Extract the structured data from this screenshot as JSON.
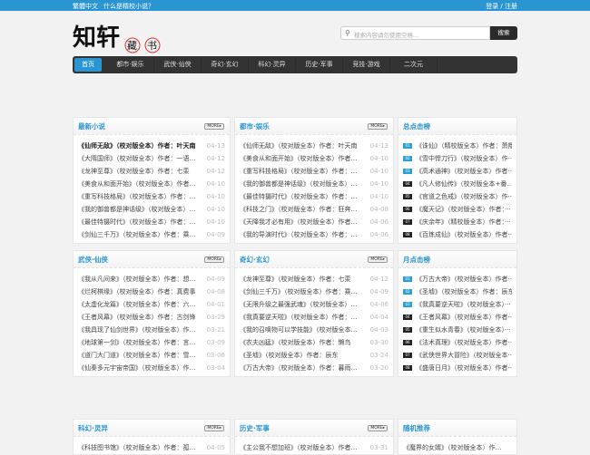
{
  "topbar": {
    "traditional": "繁體中文",
    "about": "什么是精校小说？",
    "login": "登录 / 注册"
  },
  "logo": {
    "text": "知轩藏书"
  },
  "search": {
    "placeholder": "搜索内容请勿使用空格...",
    "button": "搜索"
  },
  "nav": [
    "首页",
    "都市·娱乐",
    "武侠·仙侠",
    "奇幻·玄幻",
    "科幻·灵异",
    "历史·军事",
    "竞技·游戏",
    "二次元"
  ],
  "more": "MORE▸",
  "panels": [
    {
      "title": "最新小说",
      "items": [
        [
          "《仙师无敌》（校对版全本）作者：叶天南",
          "04-13"
        ],
        [
          "《大隋国师》（校对版全本）作者：一语破春风",
          "04-12"
        ],
        [
          "《龙神至尊》（校对版全本）作者：七栾",
          "04-12"
        ],
        [
          "《美食从和面开始》（校对版全本）作者：糖···",
          "04-10"
        ],
        [
          "《重写科技格局》（校对版全本）作者：江湖···",
          "04-10"
        ],
        [
          "《我的御兽都是神话级》（校对版全本）作者···",
          "04-10"
        ],
        [
          "《最佳特摄时代》（校对版全本）作者：粉笔白",
          "04-10"
        ],
        [
          "《剑仙三千万》（校对版全本）作者：乘风御剑",
          "04-09"
        ]
      ]
    },
    {
      "title": "都市·娱乐",
      "items": [
        [
          "《仙师无敌》（校对版全本）作者：叶天南",
          "04-13"
        ],
        [
          "《美食从和面开始》（校对版全本）作者：糖···",
          "04-10"
        ],
        [
          "《重写科技格局》（校对版全本）作者：江湖···",
          "04-10"
        ],
        [
          "《我的御兽都是神话级》（校对版全本）作者···",
          "04-10"
        ],
        [
          "《最佳特摄时代》（校对版全本）作者：粉笔白",
          "04-10"
        ],
        [
          "《科技之门》（校对版全本）作者：狂奔的黑···",
          "04-08"
        ],
        [
          "《天降我才必有用》（校对版全本）作者：石···",
          "04-06"
        ],
        [
          "《我的导演时代》（校对版全本）作者：吃饭···",
          "04-06"
        ]
      ]
    },
    {
      "title": "总点击榜",
      "items": [
        [
          "01",
          "《诛仙》（精校版全本）作者：萧鼎"
        ],
        [
          "02",
          "《雪中悍刀行》（校对版全本）作···"
        ],
        [
          "03",
          "《高术通神》（校对版全本）作者···"
        ],
        [
          "04",
          "《凡人修仙传》（校对版全本+番外···"
        ],
        [
          "05",
          "《官道之色戒》（校对版全本）作···"
        ],
        [
          "06",
          "《魔天记》（校对版全本）作者：···"
        ],
        [
          "07",
          "《庆余年》（精校版全本）作者：···"
        ],
        [
          "08",
          "《百炼成仙》（校对版全本）作者···"
        ]
      ]
    },
    {
      "title": "武侠·仙侠",
      "items": [
        [
          "《我从凡间来》（校对版全本）作者：想见江南",
          "04-09"
        ],
        [
          "《烂柯棋缘》（校对版全本）作者：真费事",
          "04-08"
        ],
        [
          "《太虚化龙篇》（校对版全本）作者：六月观主",
          "04-01"
        ],
        [
          "《王者风幕》（校对版全本）作者：古剑锋",
          "03-29"
        ],
        [
          "《我具现了仙剑世界》（校对版全本）作者：···",
          "03-21"
        ],
        [
          "《地球第一剑》（校对版全本）作者：言归正传",
          "03-09"
        ],
        [
          "《道门大门道》（校对版全本）作者：雪清欢",
          "03-06"
        ],
        [
          "《仙秦多元宇宙帝国》（校对版全本）作者：···",
          "03-04"
        ]
      ]
    },
    {
      "title": "奇幻·玄幻",
      "items": [
        [
          "《龙神至尊》（校对版全本）作者：七栾",
          "04-12"
        ],
        [
          "《剑仙三千万》（校对版全本）作者：乘风御剑",
          "04-09"
        ],
        [
          "《无限升级之最强武魂》（校对版全本）作者···",
          "04-06"
        ],
        [
          "《我真要逆天啦》（校对版全本）作者：柳一条",
          "04-04"
        ],
        [
          "《我的召唤物可以学技能》（校对版全本）作···",
          "04-03"
        ],
        [
          "《农夫凶猛》（校对版全本）作者：懒鸟",
          "03-30"
        ],
        [
          "《圣墟》（校对版全本）作者：辰东",
          "03-24"
        ],
        [
          "《万古大帝》（校对版全本）作者：暮雨神天",
          "03-20"
        ]
      ]
    },
    {
      "title": "月点击榜",
      "items": [
        [
          "01",
          "《万古大帝》（校对版全本）作者···"
        ],
        [
          "02",
          "《圣墟》（校对版全本）作者：辰东"
        ],
        [
          "03",
          "《我真要逆天啦》（校对版全本）···"
        ],
        [
          "04",
          "《王者风幕》（校对版全本）作者···"
        ],
        [
          "05",
          "《重生似水青春》（校对版全本）···"
        ],
        [
          "06",
          "《法术真理》（校对版全本）作者···"
        ],
        [
          "07",
          "《武侠世界大冒险》（校对版全本···"
        ],
        [
          "08",
          "《盛唐日月》（校对版全本）作者···"
        ]
      ]
    },
    {
      "title": "科幻·灵异",
      "items": [
        [
          "《科技图书馆》（校对版全本）作者：孤独蚂蚁",
          "04-05"
        ]
      ]
    },
    {
      "title": "历史·军事",
      "items": [
        [
          "《主公我不想加班》（校对版全本）作者：寅···",
          "03-31"
        ]
      ]
    },
    {
      "title": "随机推荐",
      "items": [
        [
          "",
          "《魔界的女婿》（校对版全本）作者：···"
        ]
      ]
    }
  ]
}
